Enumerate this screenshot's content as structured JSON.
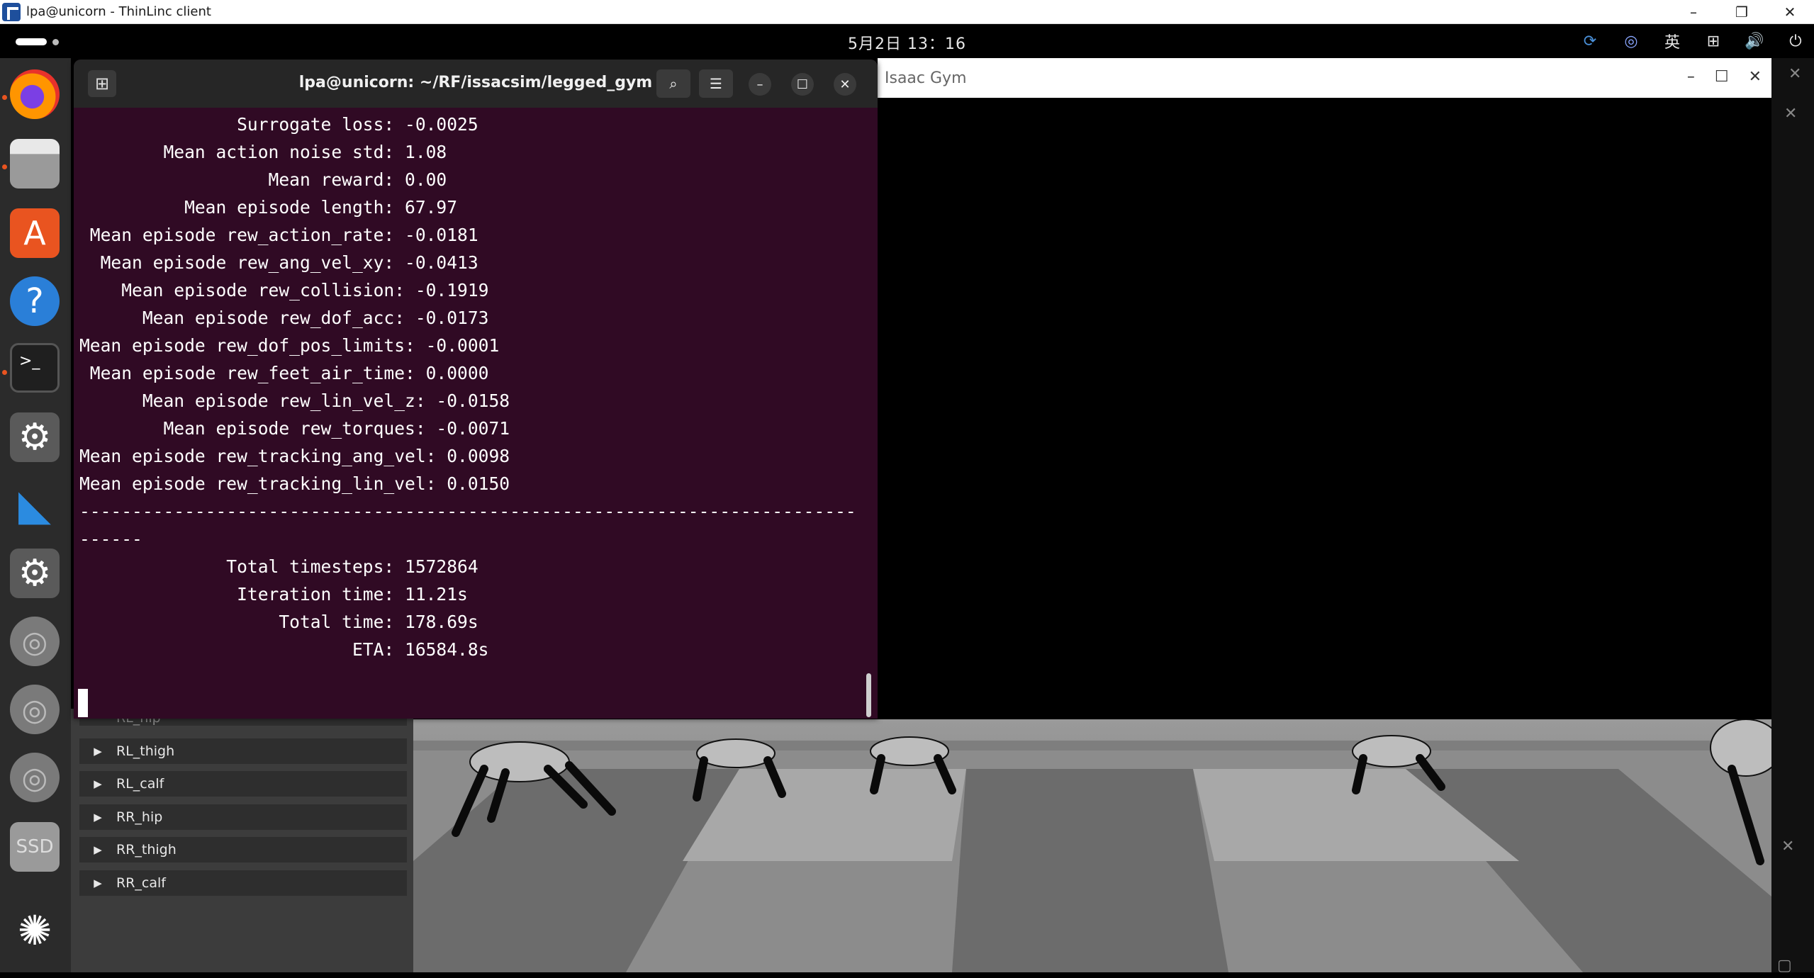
{
  "client": {
    "title": "lpa@unicorn - ThinLinc client",
    "minimize": "–",
    "restore": "❐",
    "close": "✕"
  },
  "topbar": {
    "clock": "5月2日  13：16",
    "input_method": "英"
  },
  "terminal": {
    "title": "lpa@unicorn: ~/RF/issacsim/legged_gym",
    "lines": [
      "               Surrogate loss: -0.0025",
      "        Mean action noise std: 1.08",
      "                  Mean reward: 0.00",
      "          Mean episode length: 67.97",
      " Mean episode rew_action_rate: -0.0181",
      "  Mean episode rew_ang_vel_xy: -0.0413",
      "    Mean episode rew_collision: -0.1919",
      "      Mean episode rew_dof_acc: -0.0173",
      "Mean episode rew_dof_pos_limits: -0.0001",
      " Mean episode rew_feet_air_time: 0.0000",
      "      Mean episode rew_lin_vel_z: -0.0158",
      "        Mean episode rew_torques: -0.0071",
      "Mean episode rew_tracking_ang_vel: 0.0098",
      "Mean episode rew_tracking_lin_vel: 0.0150",
      "--------------------------------------------------------------------------",
      "------",
      "              Total timesteps: 1572864",
      "               Iteration time: 11.21s",
      "                   Total time: 178.69s",
      "                          ETA: 16584.8s"
    ]
  },
  "gym": {
    "title": "Isaac Gym",
    "tree_items": [
      "RL_thigh",
      "RL_calf",
      "RR_hip",
      "RR_thigh",
      "RR_calf"
    ],
    "partial_item": "RL_hip"
  },
  "colors": {
    "terminal_bg": "#300a24",
    "dock_bg": "#2b2b2b",
    "accent": "#e95420"
  }
}
